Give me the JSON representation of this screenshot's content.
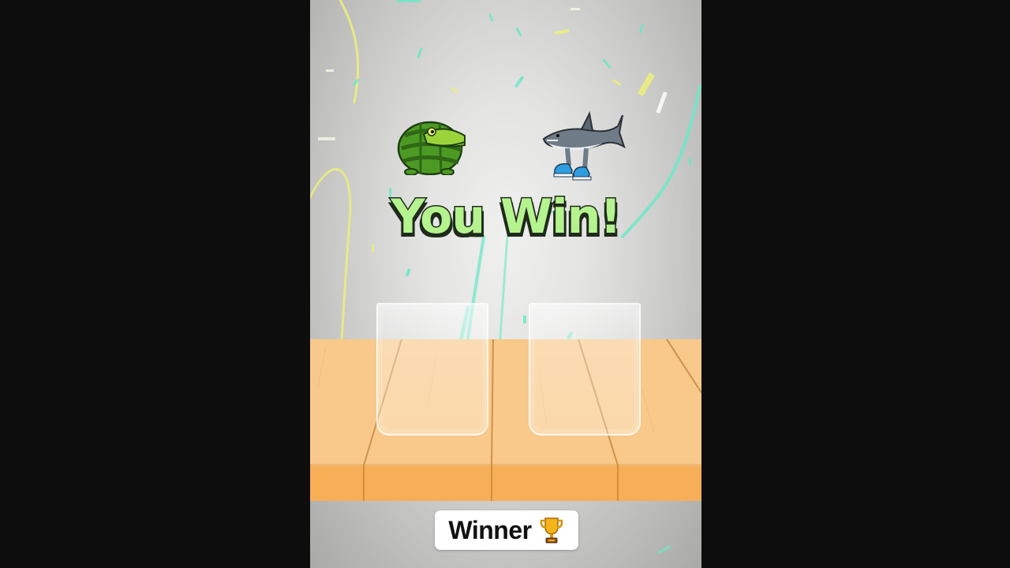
{
  "game": {
    "result_text": "You Win!",
    "badge_label": "Winner",
    "badge_icon": "trophy-icon",
    "player_character": "watermelon-crocodile",
    "opponent_character": "shark-with-sneakers",
    "cups": [
      "left-cup",
      "right-cup"
    ]
  },
  "colors": {
    "result_text": "#b5f38f",
    "table_wood": "#f8c98a",
    "confetti_teal": "#6ee7c7",
    "confetti_yellow": "#eef07a"
  }
}
